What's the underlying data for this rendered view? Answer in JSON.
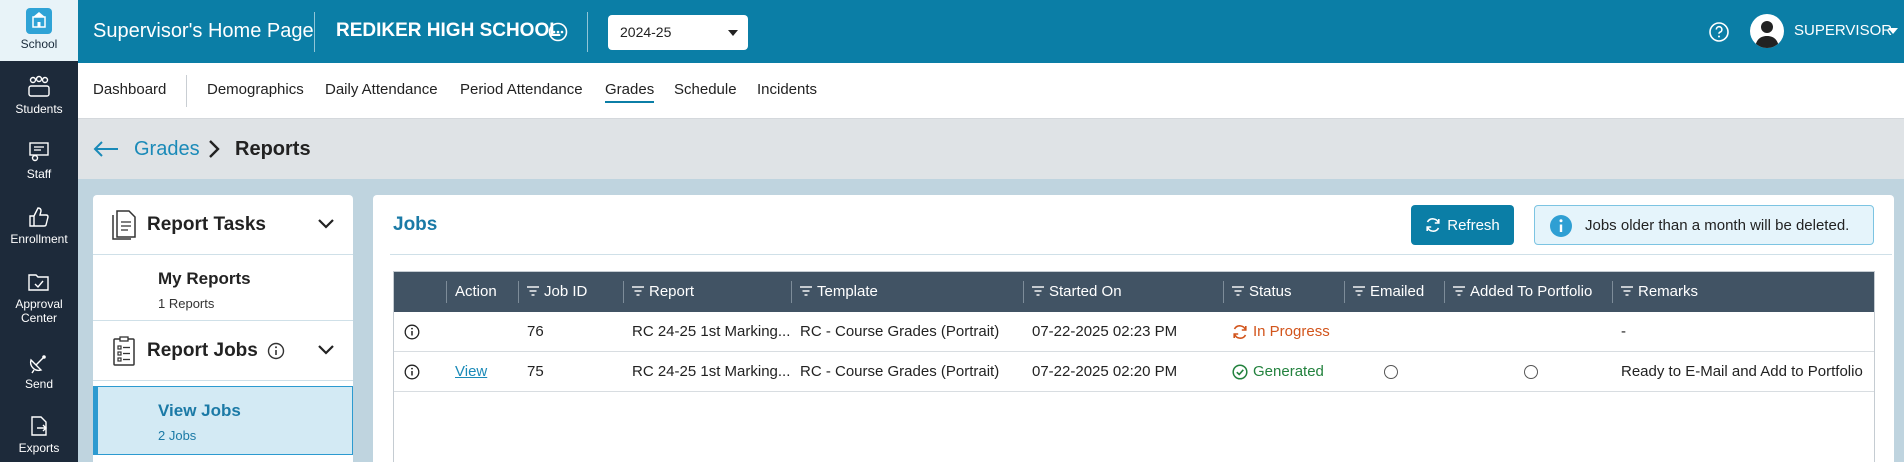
{
  "rail": {
    "items": [
      {
        "label": "School"
      },
      {
        "label": "Students"
      },
      {
        "label": "Staff"
      },
      {
        "label": "Enrollment"
      },
      {
        "label_line1": "Approval",
        "label_line2": "Center"
      },
      {
        "label": "Send"
      },
      {
        "label": "Exports"
      }
    ]
  },
  "header": {
    "title": "Supervisor's Home Page",
    "school": "REDIKER HIGH SCHOOL",
    "year": "2024-25",
    "user": "SUPERVISOR"
  },
  "nav": {
    "tabs": [
      {
        "label": "Dashboard"
      },
      {
        "label": "Demographics"
      },
      {
        "label": "Daily Attendance"
      },
      {
        "label": "Period Attendance"
      },
      {
        "label": "Grades"
      },
      {
        "label": "Schedule"
      },
      {
        "label": "Incidents"
      }
    ],
    "active": "Grades"
  },
  "breadcrumb": {
    "parent": "Grades",
    "current": "Reports"
  },
  "tasks": {
    "report_tasks": "Report Tasks",
    "my_reports": {
      "title": "My Reports",
      "sub": "1 Reports"
    },
    "report_jobs": "Report Jobs",
    "view_jobs": {
      "title": "View Jobs",
      "sub": "2 Jobs"
    }
  },
  "jobs": {
    "title": "Jobs",
    "refresh_label": "Refresh",
    "info_text": "Jobs older than a month will be deleted.",
    "columns": {
      "action": "Action",
      "job_id": "Job ID",
      "report": "Report",
      "template": "Template",
      "started_on": "Started On",
      "status": "Status",
      "emailed": "Emailed",
      "added": "Added To Portfolio",
      "remarks": "Remarks"
    },
    "rows": [
      {
        "action": "",
        "job_id": "76",
        "report": "RC 24-25 1st Marking...",
        "template": "RC - Course Grades (Portrait)",
        "started_on": "07-22-2025 02:23 PM",
        "status": "In Progress",
        "remarks": "-"
      },
      {
        "action": "View",
        "job_id": "75",
        "report": "RC 24-25 1st Marking...",
        "template": "RC - Course Grades (Portrait)",
        "started_on": "07-22-2025 02:20 PM",
        "status": "Generated",
        "remarks": "Ready to E-Mail and Add to Portfolio"
      }
    ]
  },
  "colors": {
    "header_bg": "#0b7ea6",
    "rail_bg": "#1d2a3a",
    "table_head_bg": "#415364",
    "status_in_progress": "#d2541b",
    "status_generated": "#23823e"
  }
}
